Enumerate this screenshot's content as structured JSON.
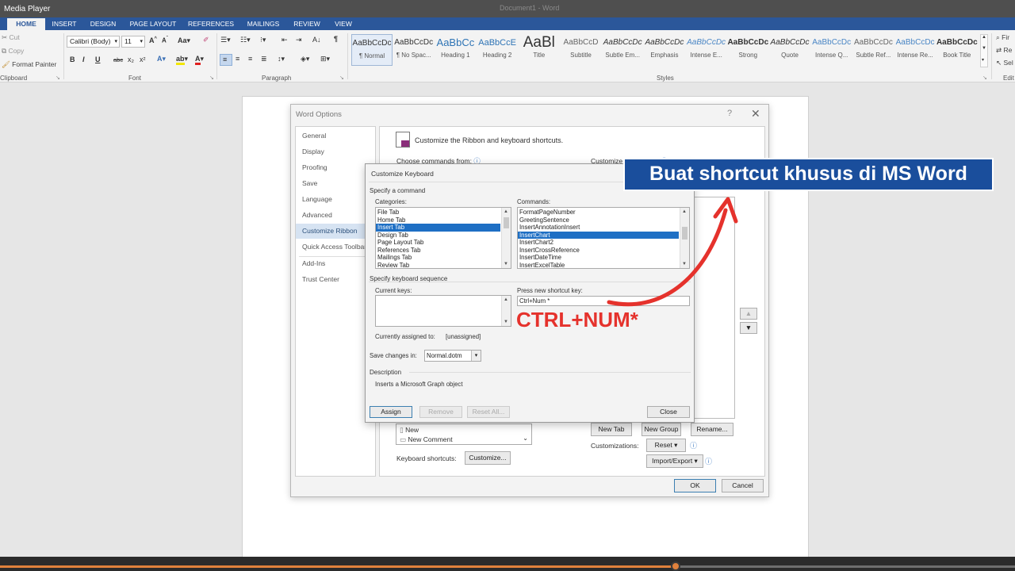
{
  "window": {
    "app_label": "Media Player",
    "doc_title": "Document1 - Word"
  },
  "ribbon_tabs": [
    "HOME",
    "INSERT",
    "DESIGN",
    "PAGE LAYOUT",
    "REFERENCES",
    "MAILINGS",
    "REVIEW",
    "VIEW"
  ],
  "clipboard": {
    "cut": "Cut",
    "copy": "Copy",
    "format_painter": "Format Painter",
    "group_label": "Clipboard"
  },
  "font": {
    "name": "Calibri (Body)",
    "size": "11",
    "group_label": "Font",
    "buttons": [
      "B",
      "I",
      "U",
      "abc",
      "x₂",
      "x²"
    ]
  },
  "paragraph": {
    "group_label": "Paragraph"
  },
  "styles": {
    "group_label": "Styles",
    "items": [
      {
        "preview": "AaBbCcDc",
        "name": "¶ Normal"
      },
      {
        "preview": "AaBbCcDc",
        "name": "¶ No Spac..."
      },
      {
        "preview": "AaBbCc",
        "name": "Heading 1"
      },
      {
        "preview": "AaBbCcE",
        "name": "Heading 2"
      },
      {
        "preview": "AaBl",
        "name": "Title"
      },
      {
        "preview": "AaBbCcD",
        "name": "Subtitle"
      },
      {
        "preview": "AaBbCcDc",
        "name": "Subtle Em..."
      },
      {
        "preview": "AaBbCcDc",
        "name": "Emphasis"
      },
      {
        "preview": "AaBbCcDc",
        "name": "Intense E..."
      },
      {
        "preview": "AaBbCcDc",
        "name": "Strong"
      },
      {
        "preview": "AaBbCcDc",
        "name": "Quote"
      },
      {
        "preview": "AaBbCcDc",
        "name": "Intense Q..."
      },
      {
        "preview": "AaBbCcDc",
        "name": "Subtle Ref..."
      },
      {
        "preview": "AaBbCcDc",
        "name": "Intense Re..."
      },
      {
        "preview": "AaBbCcDc",
        "name": "Book Title"
      }
    ]
  },
  "editing": {
    "find": "Fir",
    "replace": "Re",
    "select": "Sel",
    "group_label": "Edit"
  },
  "word_options": {
    "title": "Word Options",
    "help": "?",
    "close": "✕",
    "nav": [
      "General",
      "Display",
      "Proofing",
      "Save",
      "Language",
      "Advanced",
      "Customize Ribbon",
      "Quick Access Toolbar",
      "Add-Ins",
      "Trust Center"
    ],
    "header": "Customize the Ribbon and keyboard shortcuts.",
    "choose_commands": "Choose commands from:",
    "customize_ribbon": "Customize the Ribbon:",
    "list_items": [
      "New",
      "New Comment"
    ],
    "keyboard_shortcuts": "Keyboard shortcuts:",
    "customize_btn": "Customize...",
    "new_tab": "New Tab",
    "new_group": "New Group",
    "rename": "Rename...",
    "customizations": "Customizations:",
    "reset": "Reset ▾",
    "import_export": "Import/Export ▾",
    "ok": "OK",
    "cancel": "Cancel"
  },
  "customize_keyboard": {
    "title": "Customize Keyboard",
    "specify_command": "Specify a command",
    "categories_label": "Categories:",
    "categories": [
      "File Tab",
      "Home Tab",
      "Insert Tab",
      "Design Tab",
      "Page Layout Tab",
      "References Tab",
      "Mailings Tab",
      "Review Tab"
    ],
    "commands_label": "Commands:",
    "commands": [
      "FormatPageNumber",
      "GreetingSentence",
      "InsertAnnotationInsert",
      "InsertChart",
      "InsertChart2",
      "InsertCrossReference",
      "InsertDateTime",
      "InsertExcelTable"
    ],
    "specify_sequence": "Specify keyboard sequence",
    "current_keys": "Current keys:",
    "press_new": "Press new shortcut key:",
    "new_key_value": "Ctrl+Num *",
    "currently_assigned_label": "Currently assigned to:",
    "currently_assigned_value": "[unassigned]",
    "save_changes_label": "Save changes in:",
    "save_changes_value": "Normal.dotm",
    "description_label": "Description",
    "description_text": "Inserts a Microsoft Graph object",
    "assign": "Assign",
    "remove": "Remove",
    "reset_all": "Reset All...",
    "close": "Close"
  },
  "overlay": {
    "banner": "Buat shortcut khusus di MS Word",
    "key_hint": "CTRL+NUM*"
  },
  "media": {
    "progress": 0.666
  }
}
